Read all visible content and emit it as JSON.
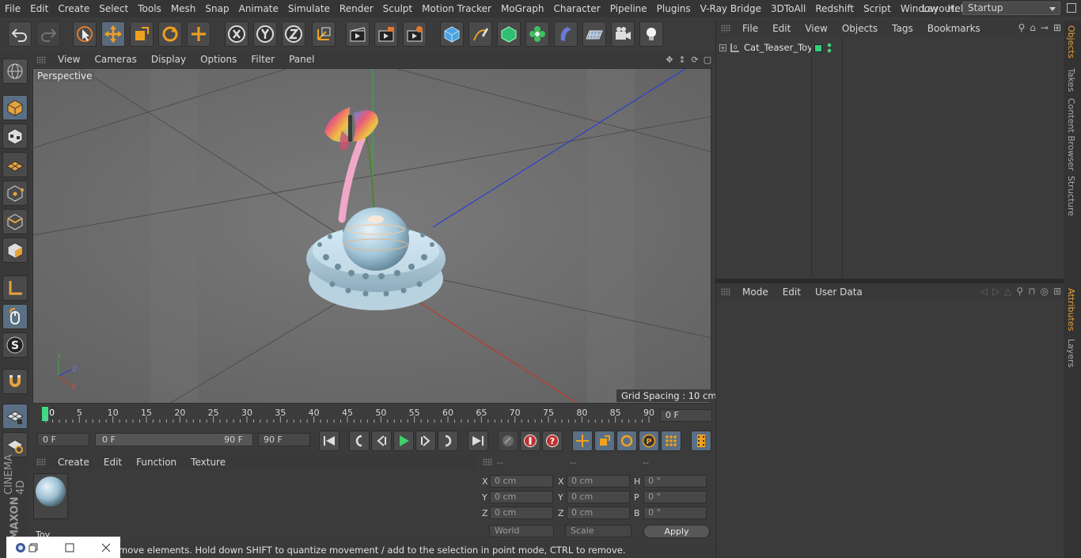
{
  "menubar": {
    "items": [
      "File",
      "Edit",
      "Create",
      "Select",
      "Tools",
      "Mesh",
      "Snap",
      "Animate",
      "Simulate",
      "Render",
      "Sculpt",
      "Motion Tracker",
      "MoGraph",
      "Character",
      "Pipeline",
      "Plugins",
      "V-Ray Bridge",
      "3DToAll",
      "Redshift",
      "Script",
      "Window",
      "Help"
    ],
    "layout_label": "Layout:",
    "layout_value": "Startup"
  },
  "viewport": {
    "menu": [
      "View",
      "Cameras",
      "Display",
      "Options",
      "Filter",
      "Panel"
    ],
    "label": "Perspective",
    "grid_spacing": "Grid Spacing : 10 cm"
  },
  "timeline": {
    "ticks": [
      "0",
      "5",
      "10",
      "15",
      "20",
      "25",
      "30",
      "35",
      "40",
      "45",
      "50",
      "55",
      "60",
      "65",
      "70",
      "75",
      "80",
      "85",
      "90"
    ],
    "current_frame": "0 F"
  },
  "transport": {
    "start_field": "0 F",
    "range_start": "0 F",
    "range_end": "90 F",
    "end_field": "90 F"
  },
  "materials": {
    "menu": [
      "Create",
      "Edit",
      "Function",
      "Texture"
    ],
    "items": [
      {
        "name": "Toy"
      }
    ]
  },
  "coords": {
    "headers": [
      "--",
      "--",
      "--"
    ],
    "rows": [
      {
        "l1": "X",
        "v1": "0 cm",
        "l2": "X",
        "v2": "0 cm",
        "l3": "H",
        "v3": "0 °"
      },
      {
        "l1": "Y",
        "v1": "0 cm",
        "l2": "Y",
        "v2": "0 cm",
        "l3": "P",
        "v3": "0 °"
      },
      {
        "l1": "Z",
        "v1": "0 cm",
        "l2": "Z",
        "v2": "0 cm",
        "l3": "B",
        "v3": "0 °"
      }
    ],
    "space": "World",
    "mode": "Scale",
    "apply": "Apply"
  },
  "status": {
    "text": "move elements. Hold down SHIFT to quantize movement / add to the selection in point mode, CTRL to remove."
  },
  "objects": {
    "menu": [
      "File",
      "Edit",
      "View",
      "Objects",
      "Tags",
      "Bookmarks"
    ],
    "items": [
      {
        "name": "Cat_Teaser_Toy"
      }
    ]
  },
  "attributes": {
    "menu": [
      "Mode",
      "Edit",
      "User Data"
    ]
  },
  "right_tabs": [
    "Objects",
    "Takes",
    "Content Browser",
    "Structure",
    "Attributes",
    "Layers"
  ],
  "brand": {
    "line1": "MAXON",
    "line2": "CINEMA 4D"
  },
  "colors": {
    "accent": "#e8a23c",
    "selection": "#5a6f84",
    "x_axis": "#c0392b",
    "y_axis": "#3fa34d",
    "z_axis": "#2a3fd1",
    "active_frame": "#3ddc84"
  }
}
